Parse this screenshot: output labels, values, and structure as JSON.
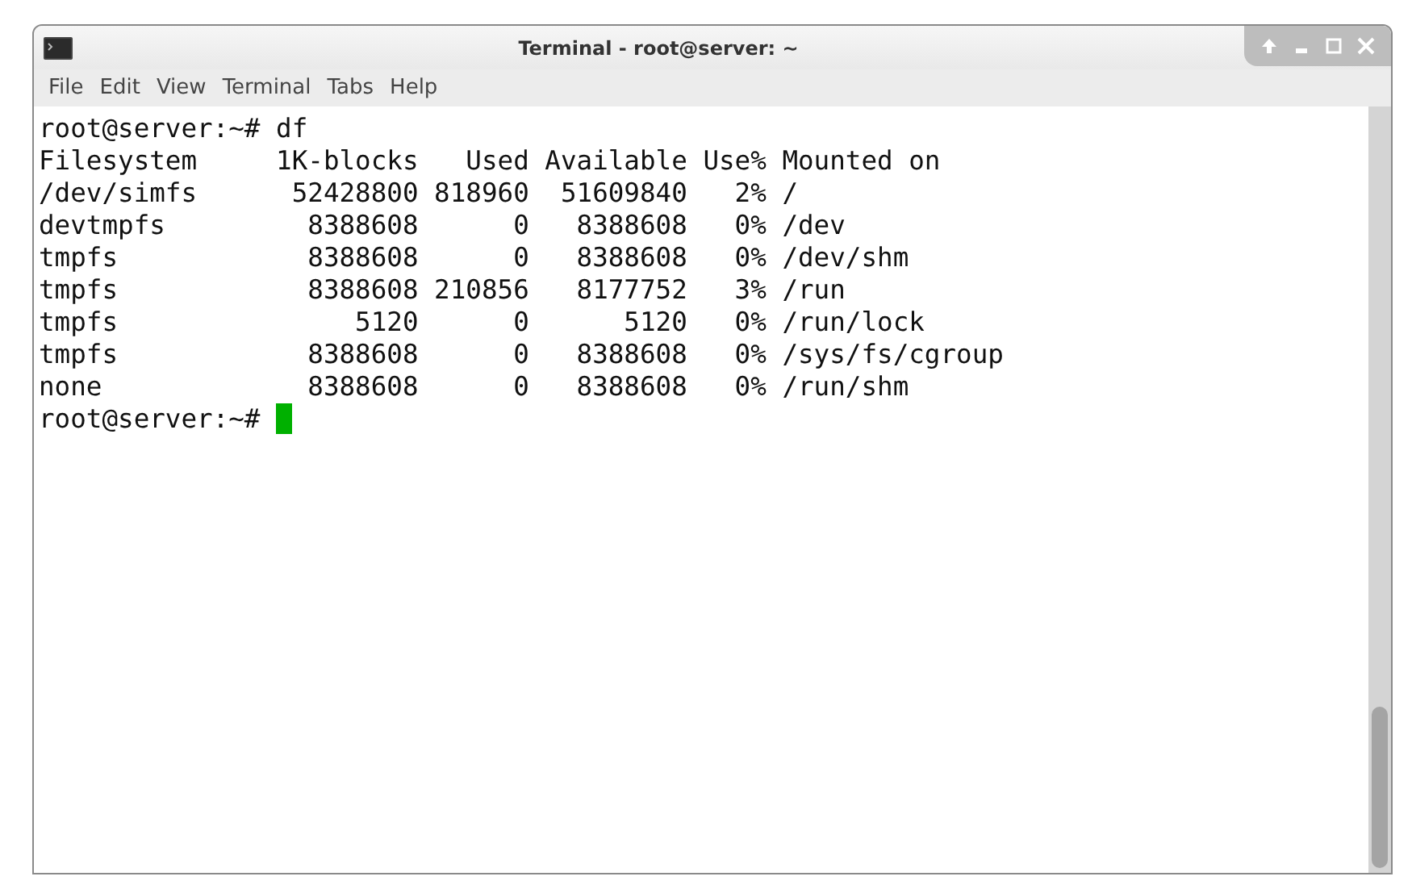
{
  "window": {
    "title": "Terminal - root@server: ~"
  },
  "menu": [
    "File",
    "Edit",
    "View",
    "Terminal",
    "Tabs",
    "Help"
  ],
  "terminal": {
    "lines": [
      "root@server:~# df",
      "Filesystem     1K-blocks   Used Available Use% Mounted on",
      "/dev/simfs      52428800 818960  51609840   2% /",
      "devtmpfs         8388608      0   8388608   0% /dev",
      "tmpfs            8388608      0   8388608   0% /dev/shm",
      "tmpfs            8388608 210856   8177752   3% /run",
      "tmpfs               5120      0      5120   0% /run/lock",
      "tmpfs            8388608      0   8388608   0% /sys/fs/cgroup",
      "none             8388608      0   8388608   0% /run/shm"
    ],
    "prompt": "root@server:~# "
  }
}
